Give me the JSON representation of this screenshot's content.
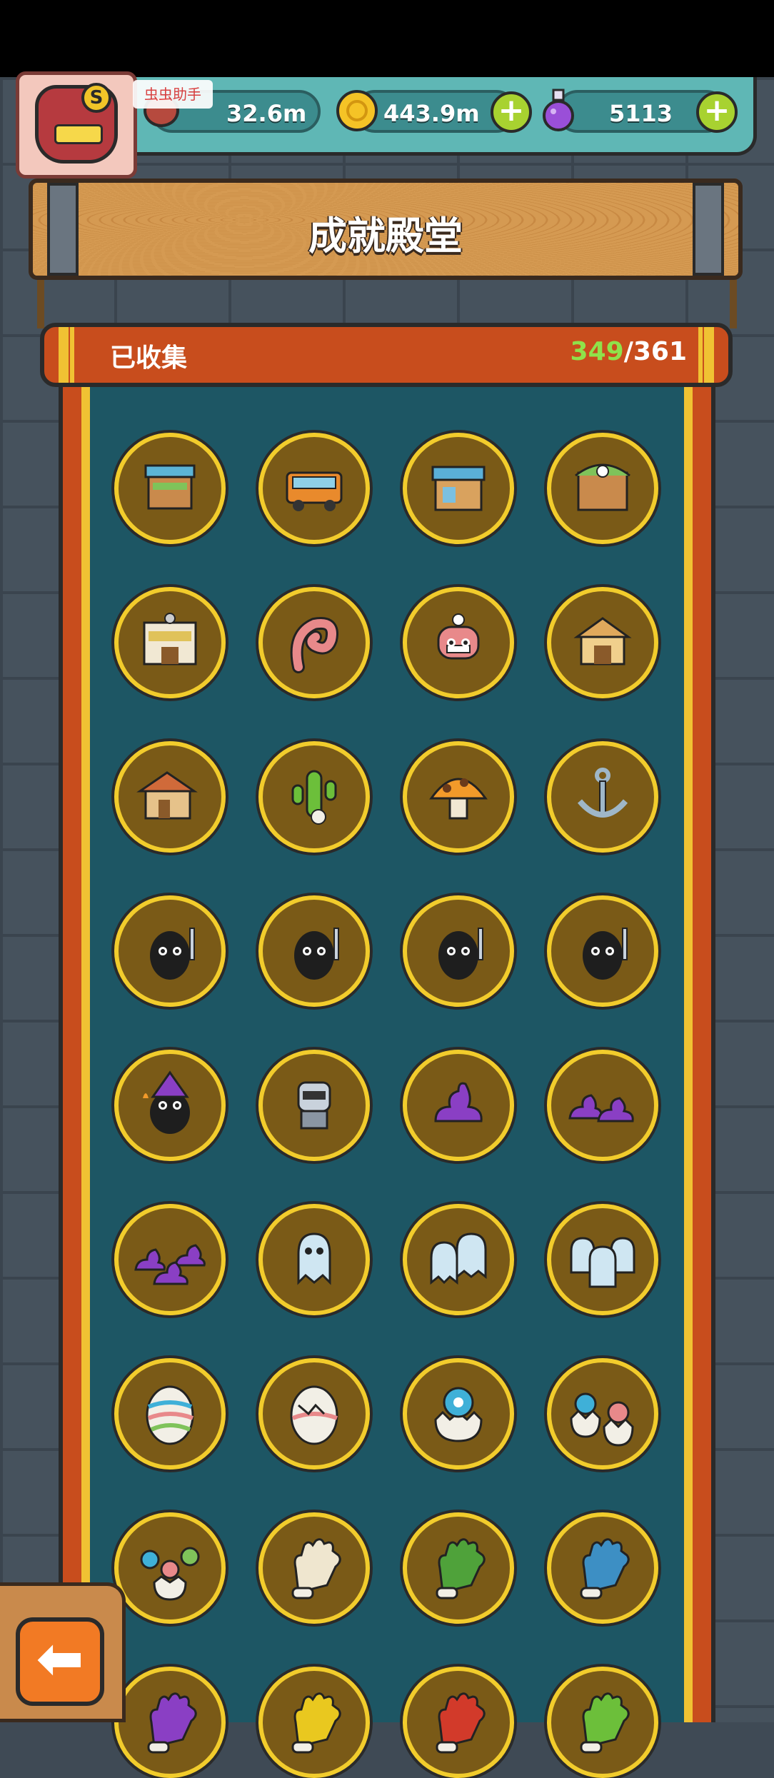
{
  "header": {
    "helper_label": "虫虫助手",
    "avatar_letter": "S",
    "resources": {
      "meat": "32.6m",
      "gold": "443.9m",
      "potion": "5113"
    },
    "add_symbol": "+"
  },
  "sign": {
    "title": "成就殿堂"
  },
  "collection": {
    "label": "已收集",
    "collected": "349",
    "separator": "/",
    "total": "361"
  },
  "badges": [
    {
      "name": "wooden-stall",
      "kind": "stall"
    },
    {
      "name": "food-truck",
      "kind": "truck"
    },
    {
      "name": "market-shop",
      "kind": "shop"
    },
    {
      "name": "monster-shop",
      "kind": "monsterhouse"
    },
    {
      "name": "grand-store",
      "kind": "store"
    },
    {
      "name": "tentacle",
      "kind": "tentacle"
    },
    {
      "name": "chef-monster",
      "kind": "chefmonster"
    },
    {
      "name": "barn",
      "kind": "barn"
    },
    {
      "name": "farmhouse",
      "kind": "farmhouse"
    },
    {
      "name": "cactus-skull",
      "kind": "cactus"
    },
    {
      "name": "mushroom",
      "kind": "mushroom"
    },
    {
      "name": "anchor",
      "kind": "anchor"
    },
    {
      "name": "blob-knife",
      "kind": "blob"
    },
    {
      "name": "blob-gun",
      "kind": "blob"
    },
    {
      "name": "blob-cleaver",
      "kind": "blob"
    },
    {
      "name": "blob-sword",
      "kind": "blob"
    },
    {
      "name": "blob-wizard",
      "kind": "wizard"
    },
    {
      "name": "robot-soldier",
      "kind": "robot"
    },
    {
      "name": "purple-goo-1",
      "kind": "goo1"
    },
    {
      "name": "purple-goo-2",
      "kind": "goo2"
    },
    {
      "name": "purple-goo-3",
      "kind": "goo3"
    },
    {
      "name": "ghost-1",
      "kind": "ghost1"
    },
    {
      "name": "ghost-2",
      "kind": "ghost2"
    },
    {
      "name": "ghost-3",
      "kind": "ghost3"
    },
    {
      "name": "egg",
      "kind": "egg"
    },
    {
      "name": "cracked-egg",
      "kind": "crackegg"
    },
    {
      "name": "hatching-egg",
      "kind": "hatch1"
    },
    {
      "name": "hatching-eggs-2",
      "kind": "hatch2"
    },
    {
      "name": "hatching-eggs-3",
      "kind": "hatch3"
    },
    {
      "name": "white-glove",
      "kind": "glove",
      "color": "#efe6cf"
    },
    {
      "name": "green-glove",
      "kind": "glove",
      "color": "#4fa23a"
    },
    {
      "name": "blue-glove",
      "kind": "glove",
      "color": "#3d8fc4"
    },
    {
      "name": "purple-glove",
      "kind": "glove",
      "color": "#8a3fc4"
    },
    {
      "name": "yellow-glove",
      "kind": "glove",
      "color": "#e9c81f"
    },
    {
      "name": "red-glove",
      "kind": "glove",
      "color": "#d23a2a"
    },
    {
      "name": "rainbow-glove",
      "kind": "glove",
      "color": "#6cbf3a"
    }
  ],
  "colors": {
    "badge_ring": "#f2cc2c",
    "collected_highlight": "#8fe24a",
    "panel_teal": "#1d5664",
    "scroll_red": "#c84d1d"
  },
  "back_button": {
    "glyph": "⬅"
  }
}
